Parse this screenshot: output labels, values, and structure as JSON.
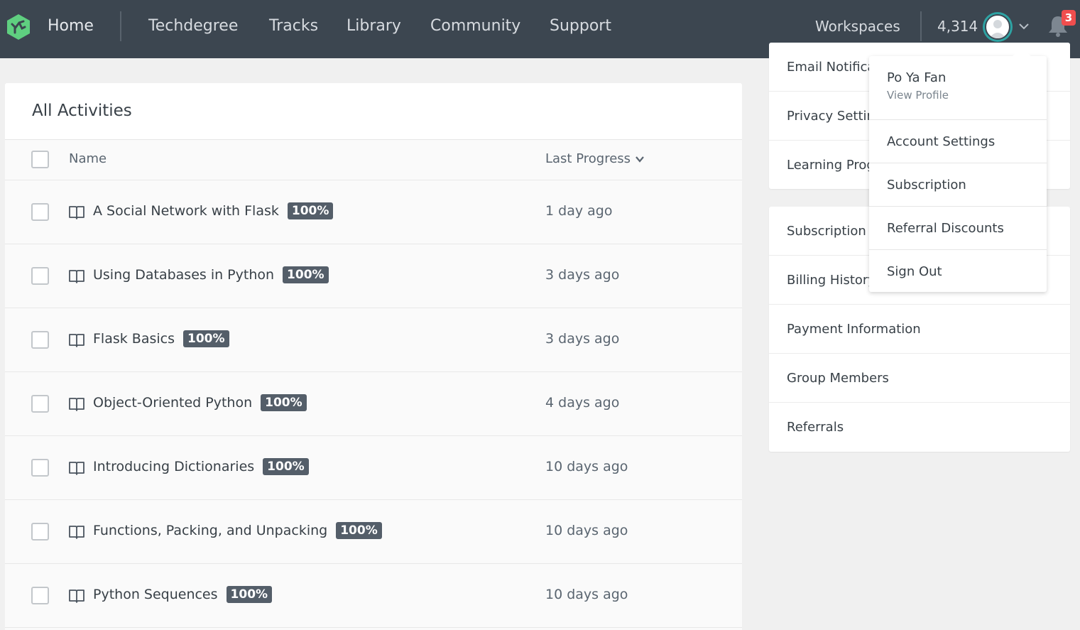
{
  "nav": {
    "home": "Home",
    "links": [
      "Techdegree",
      "Tracks",
      "Library",
      "Community",
      "Support"
    ],
    "workspaces": "Workspaces",
    "points": "4,314",
    "notifications_count": "3"
  },
  "activities": {
    "title": "All Activities",
    "col_name": "Name",
    "col_progress": "Last Progress",
    "rows": [
      {
        "title": "A Social Network with Flask",
        "percent": "100%",
        "when": "1 day ago"
      },
      {
        "title": "Using Databases in Python",
        "percent": "100%",
        "when": "3 days ago"
      },
      {
        "title": "Flask Basics",
        "percent": "100%",
        "when": "3 days ago"
      },
      {
        "title": "Object-Oriented Python",
        "percent": "100%",
        "when": "4 days ago"
      },
      {
        "title": "Introducing Dictionaries",
        "percent": "100%",
        "when": "10 days ago"
      },
      {
        "title": "Functions, Packing, and Unpacking",
        "percent": "100%",
        "when": "10 days ago"
      },
      {
        "title": "Python Sequences",
        "percent": "100%",
        "when": "10 days ago"
      }
    ]
  },
  "sidebar": {
    "card1": [
      "Email Notifications",
      "Privacy Settings",
      "Learning Progress"
    ],
    "card2": [
      "Subscription",
      "Billing History",
      "Payment Information",
      "Group Members",
      "Referrals"
    ]
  },
  "dropdown": {
    "name": "Po Ya Fan",
    "view_profile": "View Profile",
    "items": [
      "Account Settings",
      "Subscription",
      "Referral Discounts",
      "Sign Out"
    ]
  },
  "colors": {
    "nav_bg": "#3c4650",
    "brand_green": "#5fcf80",
    "badge_red": "#f04e4e",
    "percent_badge": "#545e69"
  }
}
